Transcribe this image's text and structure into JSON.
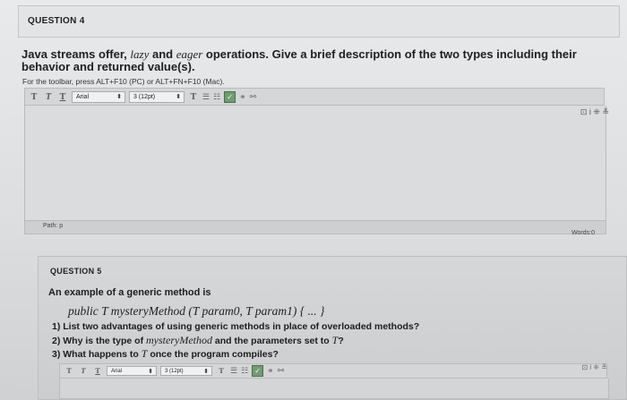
{
  "q4": {
    "header": "QUESTION 4",
    "prompt_part1": "Java streams offer, ",
    "lazy": "lazy",
    "prompt_part2": " and ",
    "eager": "eager",
    "prompt_part3": " operations. Give a brief description of the two types including their behavior and returned value(s).",
    "help": "For the toolbar, press ALT+F10 (PC) or ALT+FN+F10 (Mac).",
    "status_path": "Path: p",
    "status_words": "Words:0"
  },
  "toolbar": {
    "bold": "T",
    "italic": "T",
    "underline": "T",
    "font_family": "Arial",
    "font_size": "3 (12pt)",
    "text_color": "T",
    "list_bullet": "☰",
    "list_number": "☷",
    "check": "✓",
    "right_icons": "⊡ i ⁜ ≚"
  },
  "q5": {
    "header": "QUESTION 5",
    "intro": "An example of a generic method is",
    "code": "public T mysteryMethod (T param0, T param1) { ... }",
    "q1": "1) List two advantages of using generic methods in place of overloaded methods?",
    "q2_a": "2) Why is the type of ",
    "q2_code": "mysteryMethod",
    "q2_b": " and the parameters set to ",
    "q2_t": "T",
    "q2_c": "?",
    "q3_a": "3) What happens to ",
    "q3_t": "T",
    "q3_b": " once the program compiles?"
  }
}
